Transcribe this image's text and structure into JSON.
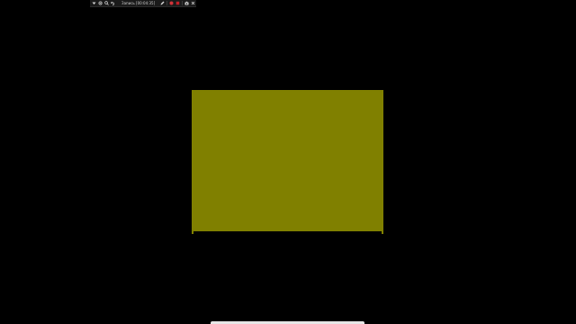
{
  "recorder": {
    "label": "Запись [00:04:35]",
    "icons": [
      "dropdown-arrow-icon",
      "settings-icon",
      "magnifier-icon",
      "undo-icon",
      "pen-icon",
      "record-icon",
      "stop-icon",
      "camera-icon",
      "close-icon"
    ]
  },
  "canvas": {
    "background_color": "#000000",
    "shape_color": "#808000"
  },
  "colors": {
    "record": "#d0343a",
    "stop": "#c21e26",
    "icon": "#d8d8d8"
  }
}
